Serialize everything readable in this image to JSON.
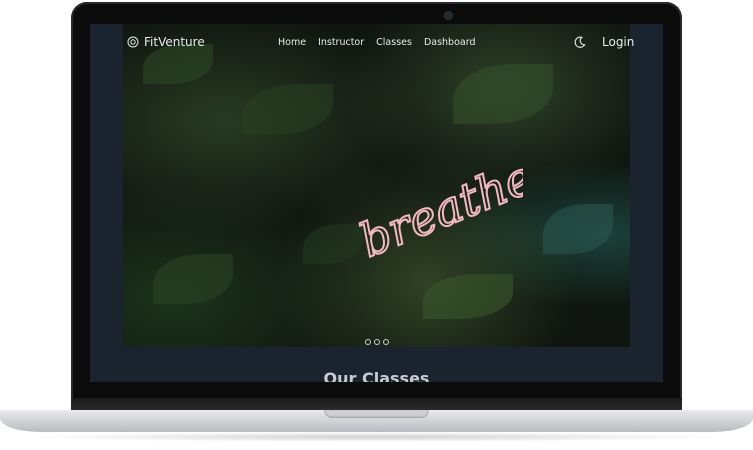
{
  "brand": {
    "name": "FitVenture",
    "icon": "logo-icon"
  },
  "nav": {
    "links": [
      "Home",
      "Instructor",
      "Classes",
      "Dashboard"
    ],
    "theme_toggle_icon": "moon-icon",
    "login_label": "Login"
  },
  "hero": {
    "neon_text": "breathe",
    "carousel_count": 3
  },
  "section": {
    "title": "Our Classes"
  },
  "colors": {
    "screen_bg": "#1b232e",
    "neon": "#f4b8c3",
    "text": "#e8ecef"
  }
}
